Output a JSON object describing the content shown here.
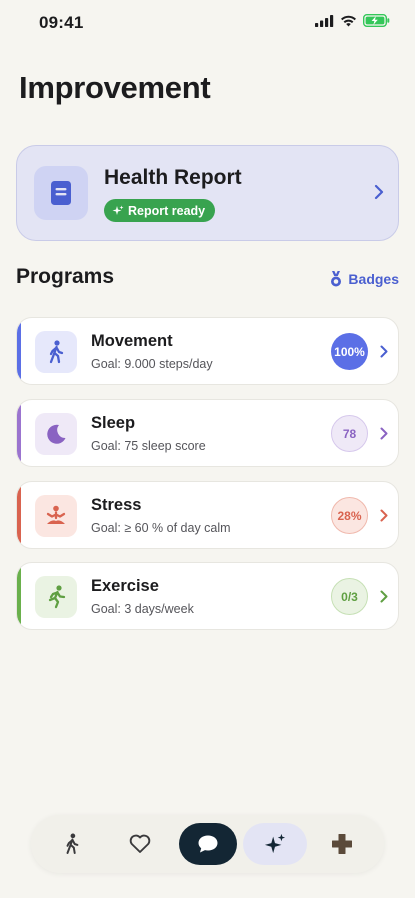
{
  "status_bar": {
    "time": "09:41"
  },
  "page": {
    "title": "Improvement"
  },
  "health_report": {
    "title": "Health Report",
    "badge": "Report ready"
  },
  "programs_section": {
    "title": "Programs",
    "badges_label": "Badges"
  },
  "programs": [
    {
      "name": "Movement",
      "goal": "Goal: 9.000 steps/day",
      "progress": "100%",
      "icon": "walking-person-icon",
      "accent": "#5b6fe6",
      "circle_bg": "#5b6fe6",
      "circle_fg": "#ffffff"
    },
    {
      "name": "Sleep",
      "goal": "Goal: 75 sleep score",
      "progress": "78",
      "icon": "moon-icon",
      "accent": "#9b74cf",
      "circle_bg": "#efe9f7",
      "circle_fg": "#8a63c2"
    },
    {
      "name": "Stress",
      "goal": "Goal: ≥ 60 % of day calm",
      "progress": "28%",
      "icon": "meditation-icon",
      "accent": "#d9634f",
      "circle_bg": "#fbe6e1",
      "circle_fg": "#d9634f"
    },
    {
      "name": "Exercise",
      "goal": "Goal: 3 days/week",
      "progress": "0/3",
      "icon": "running-person-icon",
      "accent": "#6ab04c",
      "circle_bg": "#eaf3e3",
      "circle_fg": "#5f9f42"
    }
  ],
  "tab_bar": {
    "tabs": [
      {
        "icon": "walking-person-icon"
      },
      {
        "icon": "heart-icon"
      },
      {
        "icon": "chat-bubble-icon"
      },
      {
        "icon": "sparkles-icon"
      },
      {
        "icon": "plus-cross-icon"
      }
    ]
  }
}
